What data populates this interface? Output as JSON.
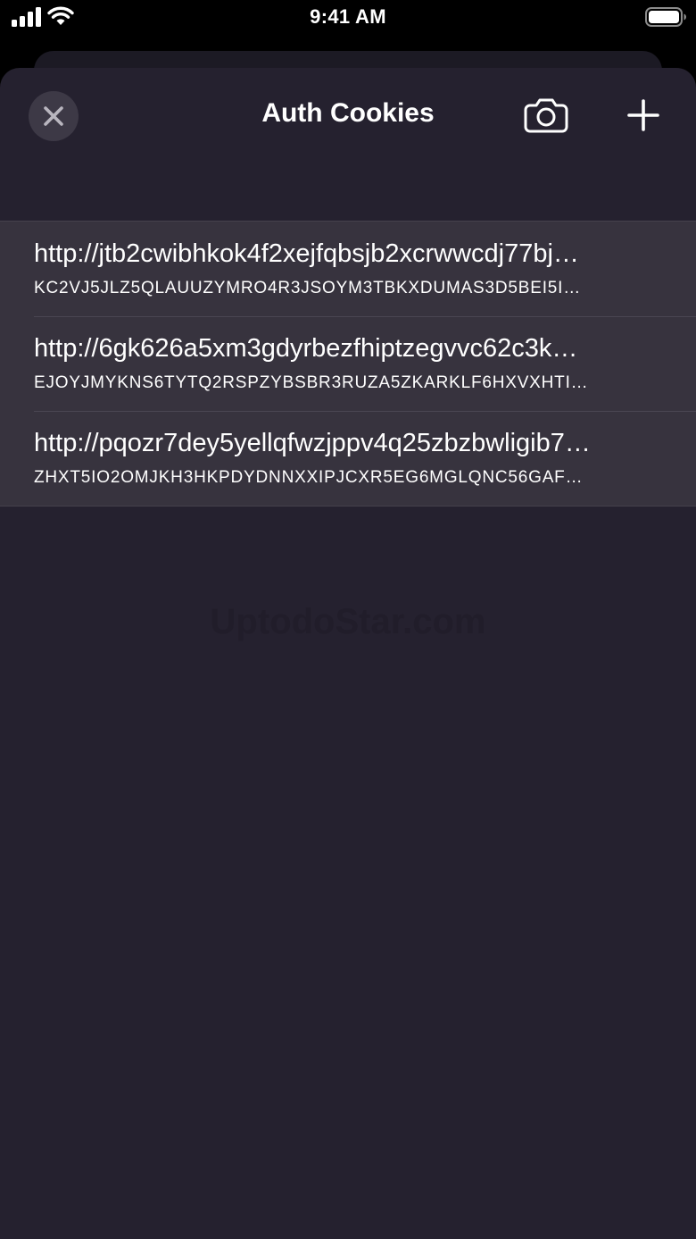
{
  "status_bar": {
    "time": "9:41 AM",
    "signal_icon": "cellular-signal-icon",
    "wifi_icon": "wifi-icon",
    "battery_icon": "battery-full-icon"
  },
  "nav": {
    "title": "Auth Cookies",
    "close_icon": "close-icon",
    "camera_icon": "camera-icon",
    "add_icon": "plus-icon"
  },
  "cookies": [
    {
      "url": "http://jtb2cwibhkok4f2xejfqbsjb2xcrwwcdj77bj…",
      "value": "KC2VJ5JLZ5QLAUUZYMRO4R3JSOYM3TBKXDUMAS3D5BEI5I…"
    },
    {
      "url": "http://6gk626a5xm3gdyrbezfhiptzegvvc62c3k…",
      "value": "EJOYJMYKNS6TYTQ2RSPZYBSBR3RUZA5ZKARKLF6HXVXHTI…"
    },
    {
      "url": "http://pqozr7dey5yellqfwzjppv4q25zbzbwligib7…",
      "value": "ZHXT5IO2OMJKH3HKPDYDNNXXIPJCXR5EG6MGLQNC56GAF…"
    }
  ],
  "watermark": "UptodoStar.com",
  "colors": {
    "background": "#000000",
    "sheet": "#25212f",
    "list_row": "#37333e",
    "close_button": "#3d3946",
    "text": "#ffffff"
  }
}
